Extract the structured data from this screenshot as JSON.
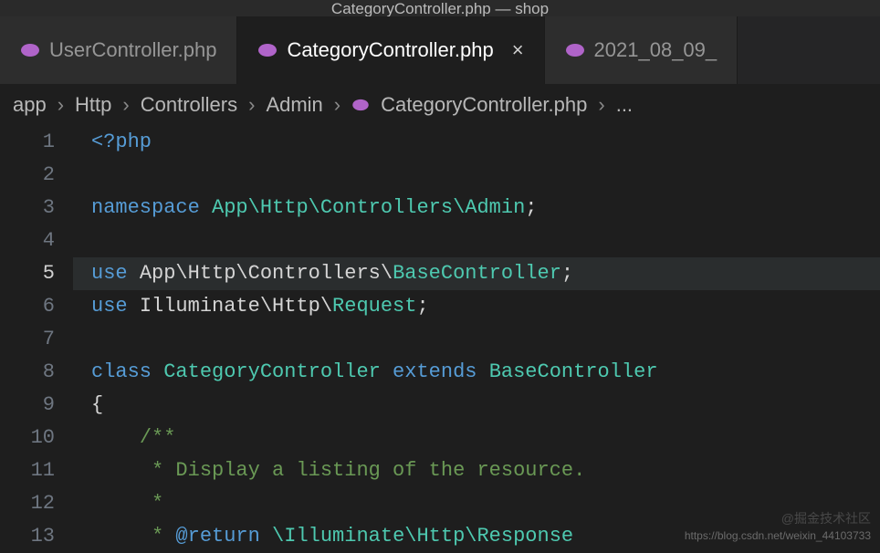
{
  "window_title": "CategoryController.php — shop",
  "tabs": [
    {
      "label": "UserController.php",
      "active": false
    },
    {
      "label": "CategoryController.php",
      "active": true
    },
    {
      "label": "2021_08_09_",
      "active": false
    }
  ],
  "breadcrumbs": {
    "parts": [
      "app",
      "Http",
      "Controllers",
      "Admin",
      "CategoryController.php"
    ],
    "trailing": "..."
  },
  "current_line": 5,
  "code": {
    "l1_open": "<?php",
    "l3_ns_kw": "namespace ",
    "l3_ns_val": "App\\Http\\Controllers\\Admin",
    "l5_use_kw": "use ",
    "l5_use_path": "App\\Http\\Controllers\\",
    "l5_use_cls": "BaseController",
    "l6_use_kw": "use ",
    "l6_use_path": "Illuminate\\Http\\",
    "l6_use_cls": "Request",
    "l8_class_kw": "class ",
    "l8_class_name": "CategoryController",
    "l8_extends_kw": " extends ",
    "l8_base": "BaseController",
    "l9_brace": "{",
    "l10_cmt": "/**",
    "l11_cmt": " * Display a listing of the resource.",
    "l12_cmt": " *",
    "l13_cmt_star": " * ",
    "l13_tag": "@return",
    "l13_space": " ",
    "l13_type": "\\Illuminate\\Http\\Response"
  },
  "line_numbers": [
    1,
    2,
    3,
    4,
    5,
    6,
    7,
    8,
    9,
    10,
    11,
    12,
    13
  ],
  "watermarks": {
    "top": "@掘金技术社区",
    "bottom": "https://blog.csdn.net/weixin_44103733"
  },
  "icons": {
    "php_color": "#b064c9"
  }
}
